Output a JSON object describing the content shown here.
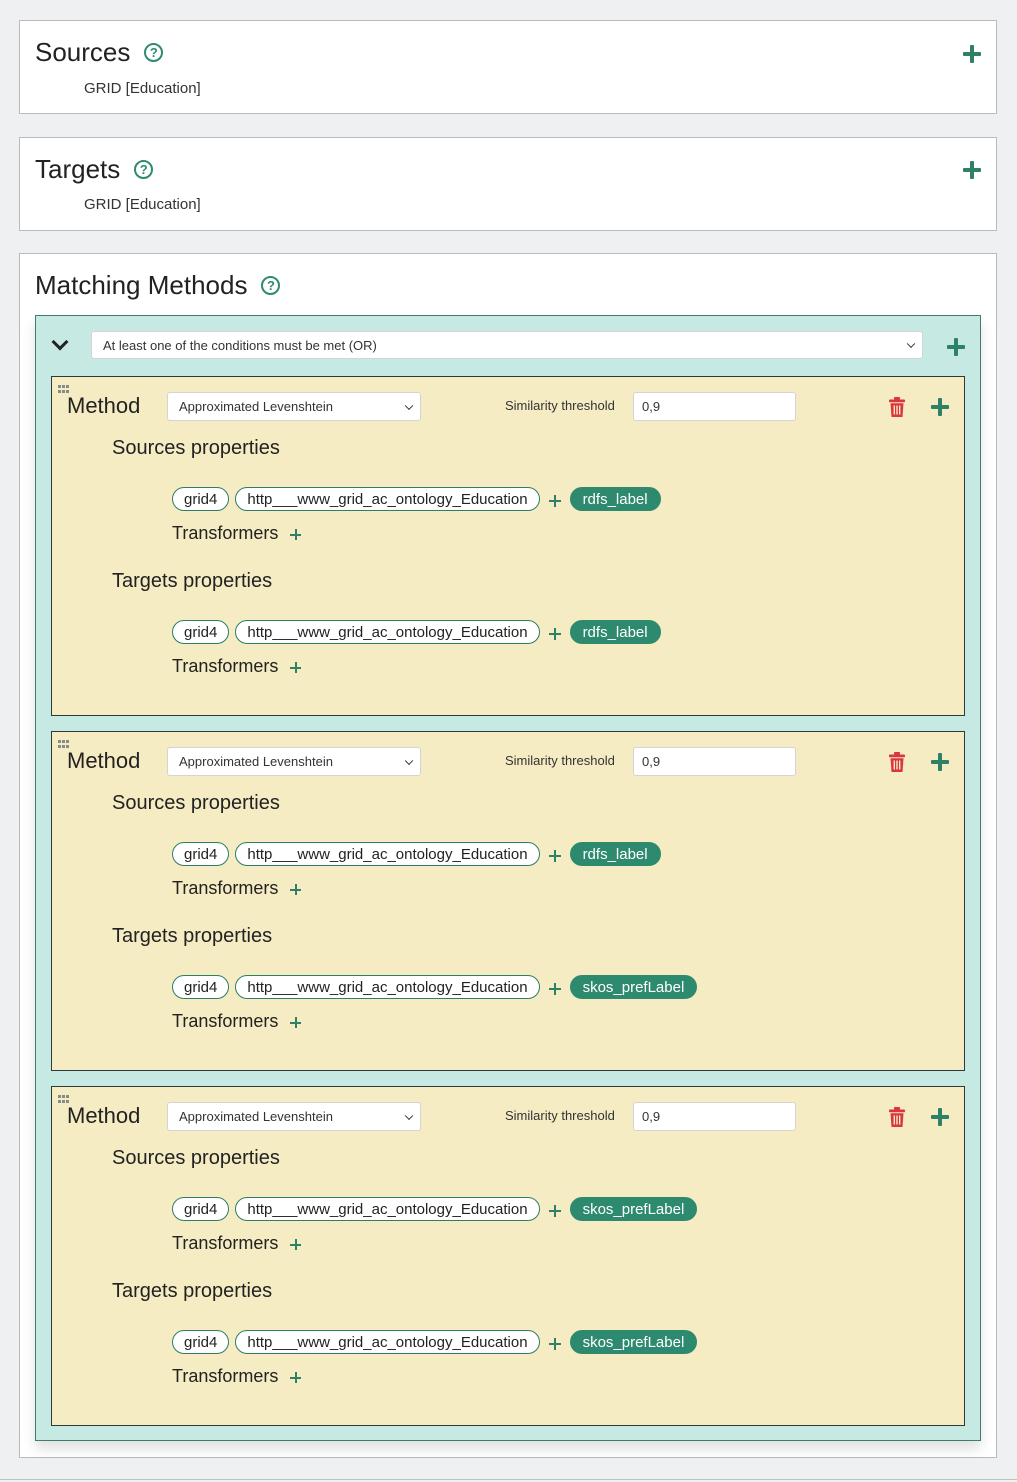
{
  "sources": {
    "title": "Sources",
    "help_icon": "question-circle-icon",
    "value": "GRID [Education]",
    "add_icon": "plus-icon"
  },
  "targets": {
    "title": "Targets",
    "help_icon": "question-circle-icon",
    "value": "GRID [Education]",
    "add_icon": "plus-icon"
  },
  "matching_methods": {
    "title": "Matching Methods",
    "help_icon": "question-circle-icon",
    "group": {
      "collapse_icon": "chevron-down-icon",
      "condition_selected": "At least one of the conditions must be met (OR)",
      "add_icon": "plus-icon",
      "methods": [
        {
          "label": "Method",
          "method_selected": "Approximated Levenshtein",
          "threshold_label": "Similarity threshold",
          "threshold_value": "0,9",
          "sources_heading": "Sources properties",
          "sources_path": [
            "grid4",
            "http___www_grid_ac_ontology_Education"
          ],
          "sources_property": "rdfs_label",
          "sources_transformers": "Transformers",
          "targets_heading": "Targets properties",
          "targets_path": [
            "grid4",
            "http___www_grid_ac_ontology_Education"
          ],
          "targets_property": "rdfs_label",
          "targets_transformers": "Transformers"
        },
        {
          "label": "Method",
          "method_selected": "Approximated Levenshtein",
          "threshold_label": "Similarity threshold",
          "threshold_value": "0,9",
          "sources_heading": "Sources properties",
          "sources_path": [
            "grid4",
            "http___www_grid_ac_ontology_Education"
          ],
          "sources_property": "rdfs_label",
          "sources_transformers": "Transformers",
          "targets_heading": "Targets properties",
          "targets_path": [
            "grid4",
            "http___www_grid_ac_ontology_Education"
          ],
          "targets_property": "skos_prefLabel",
          "targets_transformers": "Transformers"
        },
        {
          "label": "Method",
          "method_selected": "Approximated Levenshtein",
          "threshold_label": "Similarity threshold",
          "threshold_value": "0,9",
          "sources_heading": "Sources properties",
          "sources_path": [
            "grid4",
            "http___www_grid_ac_ontology_Education"
          ],
          "sources_property": "skos_prefLabel",
          "sources_transformers": "Transformers",
          "targets_heading": "Targets properties",
          "targets_path": [
            "grid4",
            "http___www_grid_ac_ontology_Education"
          ],
          "targets_property": "skos_prefLabel",
          "targets_transformers": "Transformers"
        }
      ]
    }
  },
  "colors": {
    "accent": "#2e8a6e",
    "delete": "#d9363e",
    "group_bg": "#c6eae3",
    "method_bg": "#f5ecc3"
  }
}
